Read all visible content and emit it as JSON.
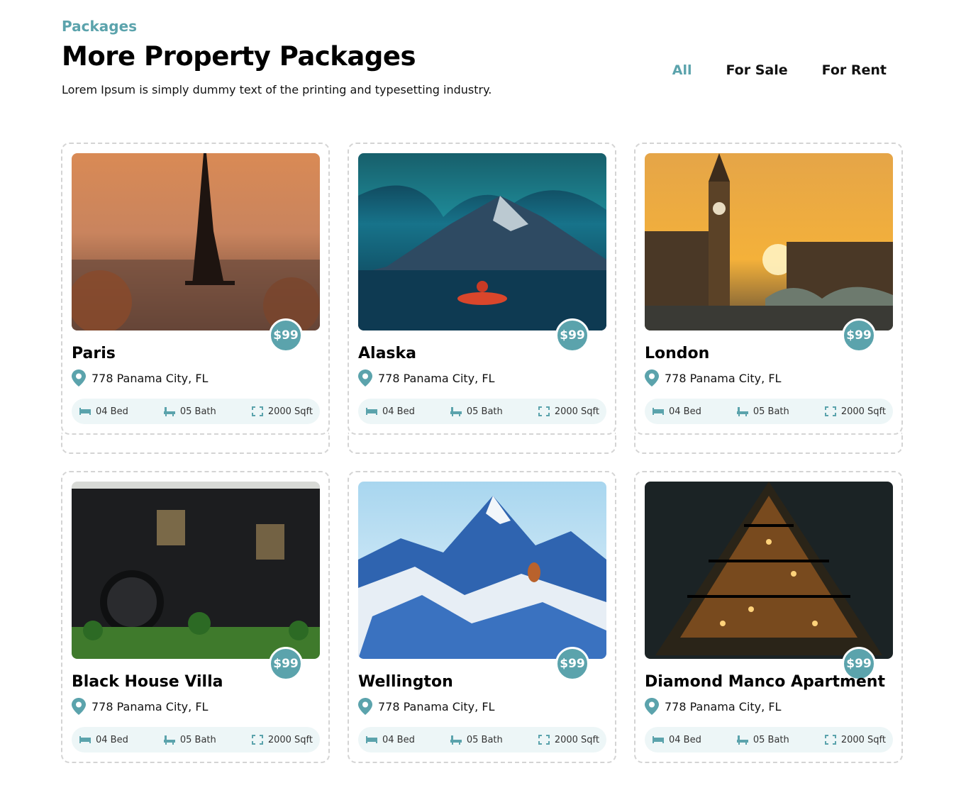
{
  "header": {
    "eyebrow": "Packages",
    "title": "More Property Packages",
    "subtitle": "Lorem Ipsum is simply dummy text of the printing and typesetting industry."
  },
  "filters": [
    {
      "label": "All",
      "active": true
    },
    {
      "label": "For Sale",
      "active": false
    },
    {
      "label": "For Rent",
      "active": false
    }
  ],
  "colors": {
    "accent": "#5ba3ac",
    "spec_bg": "#edf6f7"
  },
  "cards": [
    {
      "name": "Paris",
      "price": "$99",
      "address": "778 Panama City, FL",
      "bed": "04 Bed",
      "bath": "05 Bath",
      "area": "2000 Sqft",
      "image": "eiffel-tower-sunset"
    },
    {
      "name": "Alaska",
      "price": "$99",
      "address": "778 Panama City, FL",
      "bed": "04 Bed",
      "bath": "05 Bath",
      "area": "2000 Sqft",
      "image": "aurora-mountain-lake"
    },
    {
      "name": "London",
      "price": "$99",
      "address": "778 Panama City, FL",
      "bed": "04 Bed",
      "bath": "05 Bath",
      "area": "2000 Sqft",
      "image": "big-ben-sunset"
    },
    {
      "name": "Black House Villa",
      "price": "$99",
      "address": "778 Panama City, FL",
      "bed": "04 Bed",
      "bath": "05 Bath",
      "area": "2000 Sqft",
      "image": "black-villa"
    },
    {
      "name": "Wellington",
      "price": "$99",
      "address": "778 Panama City, FL",
      "bed": "04 Bed",
      "bath": "05 Bath",
      "area": "2000 Sqft",
      "image": "snowy-mountains"
    },
    {
      "name": "Diamond Manco Apartment",
      "price": "$99",
      "address": "778 Panama City, FL",
      "bed": "04 Bed",
      "bath": "05 Bath",
      "area": "2000 Sqft",
      "image": "pyramid-house-night"
    }
  ]
}
